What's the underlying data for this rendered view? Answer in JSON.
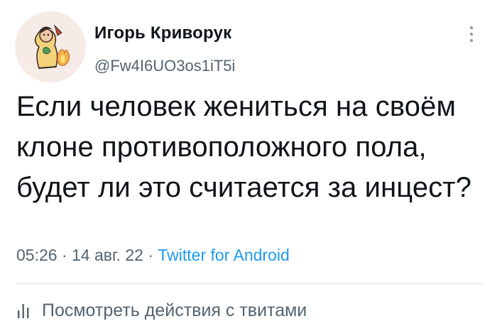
{
  "author": {
    "name": "Игорь Криворук",
    "handle": "@Fw4I6UO3os1iT5i",
    "avatar_icon": "avatar-illustration"
  },
  "tweet": {
    "text": "Если человек жениться на своём клоне противоположного пола, будет ли это считается за инцест?",
    "time": "05:26",
    "separator": " · ",
    "date": "14 авг. 22",
    "source": "Twitter for Android"
  },
  "actions": {
    "more_icon": "more-vertical-icon",
    "activity_icon": "analytics-icon",
    "activity_label": "Посмотреть действия с твитами"
  },
  "colors": {
    "text": "#0f1419",
    "secondary": "#536471",
    "accent": "#1d9bf0",
    "divider": "#e1e5e8"
  }
}
